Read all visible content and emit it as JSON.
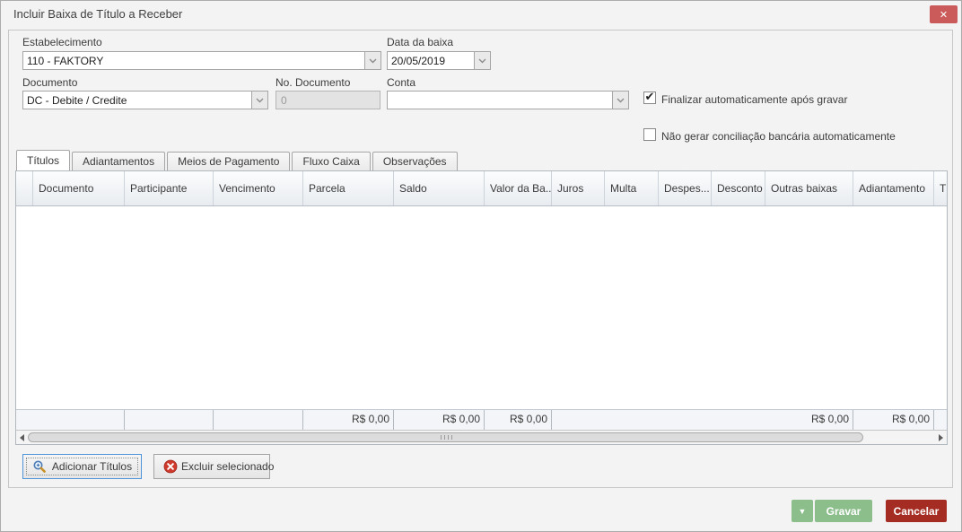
{
  "window": {
    "title": "Incluir Baixa de Título a Receber"
  },
  "icons": {
    "close": "✕",
    "dropdown": "▼",
    "check": "✔"
  },
  "form": {
    "estabelecimento": {
      "label": "Estabelecimento",
      "value": "110 - FAKTORY"
    },
    "data_baixa": {
      "label": "Data da baixa",
      "value": "20/05/2019"
    },
    "documento": {
      "label": "Documento",
      "value": "DC - Debite / Credite"
    },
    "no_documento": {
      "label": "No. Documento",
      "value": "0"
    },
    "conta": {
      "label": "Conta",
      "value": ""
    },
    "checkbox_finalizar": {
      "label": "Finalizar automaticamente após gravar",
      "checked": true
    },
    "checkbox_conciliacao": {
      "label": "Não gerar conciliação bancária automaticamente",
      "checked": false
    }
  },
  "tabs": {
    "items": [
      {
        "label": "Títulos",
        "active": true
      },
      {
        "label": "Adiantamentos",
        "active": false
      },
      {
        "label": "Meios de Pagamento",
        "active": false
      },
      {
        "label": "Fluxo Caixa",
        "active": false
      },
      {
        "label": "Observações",
        "active": false
      }
    ]
  },
  "grid": {
    "columns": [
      {
        "label": ""
      },
      {
        "label": "Documento"
      },
      {
        "label": "Participante"
      },
      {
        "label": "Vencimento"
      },
      {
        "label": "Parcela",
        "footer": "R$ 0,00"
      },
      {
        "label": "Saldo",
        "footer": "R$ 0,00"
      },
      {
        "label": "Valor da Ba...",
        "footer": "R$ 0,00"
      },
      {
        "label": "Juros"
      },
      {
        "label": "Multa"
      },
      {
        "label": "Despes..."
      },
      {
        "label": "Desconto"
      },
      {
        "label": "Outras baixas",
        "footer": "R$ 0,00"
      },
      {
        "label": "Adiantamento",
        "footer": "R$ 0,00"
      },
      {
        "label": "T"
      }
    ],
    "rows": []
  },
  "buttons": {
    "add_titles": "Adicionar Títulos",
    "delete_selected": "Excluir selecionado",
    "save": "Gravar",
    "cancel": "Cancelar"
  }
}
